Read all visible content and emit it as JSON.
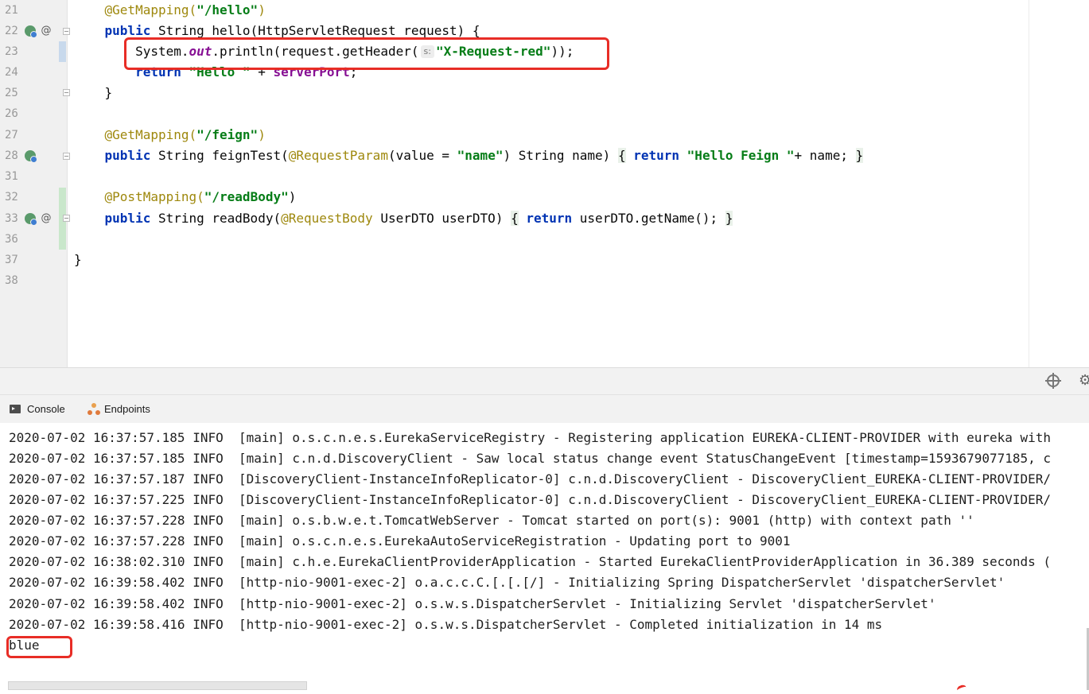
{
  "editor": {
    "lines": [
      {
        "num": "21",
        "tokens": [
          {
            "t": "    "
          },
          {
            "t": "@GetMapping(",
            "c": "ann"
          },
          {
            "t": "\"/hello\"",
            "c": "str"
          },
          {
            "t": ")",
            "c": "ann"
          }
        ]
      },
      {
        "num": "22",
        "tokens": [
          {
            "t": "    "
          },
          {
            "t": "public",
            "c": "kw"
          },
          {
            "t": " String hello(HttpServletRequest request) {"
          }
        ]
      },
      {
        "num": "23",
        "tokens": [
          {
            "t": "        System."
          },
          {
            "t": "out",
            "c": "static"
          },
          {
            "t": ".println(request.getHeader("
          },
          {
            "hint": "s:"
          },
          {
            "t": "\"X-Request-red\"",
            "c": "str"
          },
          {
            "t": "));"
          }
        ]
      },
      {
        "num": "24",
        "tokens": [
          {
            "t": "        "
          },
          {
            "t": "return",
            "c": "kw"
          },
          {
            "t": " "
          },
          {
            "t": "\"Hello \"",
            "c": "str"
          },
          {
            "t": " + "
          },
          {
            "t": "serverPort",
            "c": "field"
          },
          {
            "t": ";"
          }
        ]
      },
      {
        "num": "25",
        "tokens": [
          {
            "t": "    }"
          }
        ]
      },
      {
        "num": "26",
        "tokens": []
      },
      {
        "num": "27",
        "tokens": [
          {
            "t": "    "
          },
          {
            "t": "@GetMapping(",
            "c": "ann"
          },
          {
            "t": "\"/feign\"",
            "c": "str"
          },
          {
            "t": ")",
            "c": "ann"
          }
        ]
      },
      {
        "num": "28",
        "tokens": [
          {
            "t": "    "
          },
          {
            "t": "public",
            "c": "kw"
          },
          {
            "t": " String feignTest("
          },
          {
            "t": "@RequestParam",
            "c": "ann"
          },
          {
            "t": "(value = "
          },
          {
            "t": "\"name\"",
            "c": "str"
          },
          {
            "t": ") String name) "
          },
          {
            "t": "{",
            "c": "brace-hl"
          },
          {
            "t": " "
          },
          {
            "t": "return",
            "c": "kw"
          },
          {
            "t": " "
          },
          {
            "t": "\"Hello Feign \"",
            "c": "str"
          },
          {
            "t": "+ name; "
          },
          {
            "t": "}",
            "c": "brace-hl"
          }
        ]
      },
      {
        "num": "31",
        "tokens": []
      },
      {
        "num": "32",
        "tokens": [
          {
            "t": "    "
          },
          {
            "t": "@PostMapping(",
            "c": "ann"
          },
          {
            "t": "\"/readBody\"",
            "c": "str"
          },
          {
            "t": ")"
          }
        ]
      },
      {
        "num": "33",
        "tokens": [
          {
            "t": "    "
          },
          {
            "t": "public",
            "c": "kw"
          },
          {
            "t": " String readBody("
          },
          {
            "t": "@RequestBody",
            "c": "ann"
          },
          {
            "t": " UserDTO userDTO) "
          },
          {
            "t": "{",
            "c": "brace-hl"
          },
          {
            "t": " "
          },
          {
            "t": "return",
            "c": "kw"
          },
          {
            "t": " userDTO.getName(); "
          },
          {
            "t": "}",
            "c": "brace-hl"
          }
        ]
      },
      {
        "num": "36",
        "tokens": []
      },
      {
        "num": "37",
        "tokens": [
          {
            "t": "}"
          }
        ]
      },
      {
        "num": "38",
        "tokens": []
      }
    ]
  },
  "tabs": {
    "console": "Console",
    "endpoints": "Endpoints"
  },
  "console": {
    "lines": [
      "2020-07-02 16:37:57.185 INFO  [main] o.s.c.n.e.s.EurekaServiceRegistry - Registering application EUREKA-CLIENT-PROVIDER with eureka with",
      "2020-07-02 16:37:57.185 INFO  [main] c.n.d.DiscoveryClient - Saw local status change event StatusChangeEvent [timestamp=1593679077185, c",
      "2020-07-02 16:37:57.187 INFO  [DiscoveryClient-InstanceInfoReplicator-0] c.n.d.DiscoveryClient - DiscoveryClient_EUREKA-CLIENT-PROVIDER/",
      "2020-07-02 16:37:57.225 INFO  [DiscoveryClient-InstanceInfoReplicator-0] c.n.d.DiscoveryClient - DiscoveryClient_EUREKA-CLIENT-PROVIDER/",
      "2020-07-02 16:37:57.228 INFO  [main] o.s.b.w.e.t.TomcatWebServer - Tomcat started on port(s): 9001 (http) with context path ''",
      "2020-07-02 16:37:57.228 INFO  [main] o.s.c.n.e.s.EurekaAutoServiceRegistration - Updating port to 9001",
      "2020-07-02 16:38:02.310 INFO  [main] c.h.e.EurekaClientProviderApplication - Started EurekaClientProviderApplication in 36.389 seconds (",
      "2020-07-02 16:39:58.402 INFO  [http-nio-9001-exec-2] o.a.c.c.C.[.[.[/] - Initializing Spring DispatcherServlet 'dispatcherServlet'",
      "2020-07-02 16:39:58.402 INFO  [http-nio-9001-exec-2] o.s.w.s.DispatcherServlet - Initializing Servlet 'dispatcherServlet'",
      "2020-07-02 16:39:58.416 INFO  [http-nio-9001-exec-2] o.s.w.s.DispatcherServlet - Completed initialization in 14 ms",
      "blue"
    ]
  }
}
